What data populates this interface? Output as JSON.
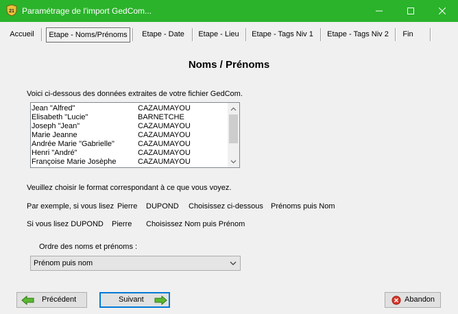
{
  "window": {
    "title": "Paramétrage de l'import GedCom...",
    "icon": "gedcom-app-icon",
    "accent": "#2bb32b"
  },
  "tabs": [
    {
      "label": "Accueil"
    },
    {
      "label": "Etape - Noms/Prénoms",
      "active": true
    },
    {
      "label": "Etape - Date"
    },
    {
      "label": "Etape - Lieu"
    },
    {
      "label": "Etape - Tags Niv 1"
    },
    {
      "label": "Etape - Tags Niv 2"
    },
    {
      "label": "Fin"
    }
  ],
  "page_title": "Noms / Prénoms",
  "intro_text": "Voici ci-dessous des données extraites de votre fichier GedCom.",
  "names_list": [
    {
      "first": "Jean \"Alfred\"",
      "last": "CAZAUMAYOU"
    },
    {
      "first": "Elisabeth \"Lucie\"",
      "last": "BARNETCHE"
    },
    {
      "first": "Joseph \"Jean\"",
      "last": "CAZAUMAYOU"
    },
    {
      "first": "Marie Jeanne",
      "last": "CAZAUMAYOU"
    },
    {
      "first": "Andrée Marie \"Gabrielle\"",
      "last": "CAZAUMAYOU"
    },
    {
      "first": "Henri \"André\"",
      "last": "CAZAUMAYOU"
    },
    {
      "first": "Françoise Marie Josèphe",
      "last": "CAZAUMAYOU"
    }
  ],
  "instruction_text": "Veuillez choisir le format correspondant à ce que vous voyez.",
  "example1": {
    "lead": "Par exemple, si vous lisez",
    "first": "Pierre",
    "last": "DUPOND",
    "choose": "Choisissez ci-dessous",
    "result": "Prénoms puis Nom"
  },
  "example2": {
    "lead": "Si vous lisez DUPOND",
    "first": "Pierre",
    "choose": "Choisissez Nom puis Prénom"
  },
  "order_label": "Ordre des noms et prénoms :",
  "order_select": {
    "value": "Prénom puis nom"
  },
  "buttons": {
    "previous": "Précédent",
    "next": "Suivant",
    "cancel": "Abandon"
  }
}
